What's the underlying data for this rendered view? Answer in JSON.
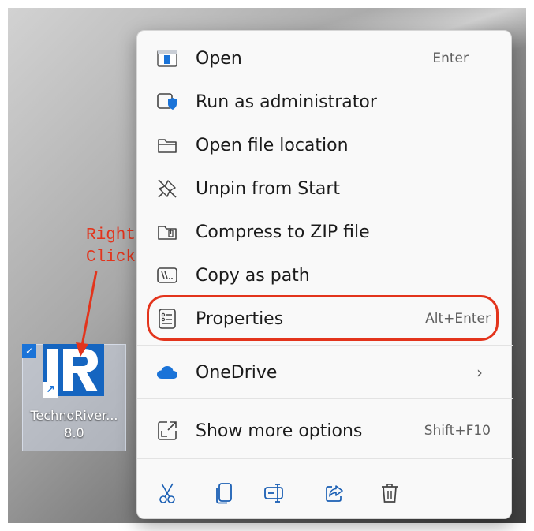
{
  "desktop": {
    "icon": {
      "label_line1": "TechnoRiver...",
      "label_line2": "8.0",
      "logo_letters": "IR",
      "checkbox_glyph": "✓",
      "shortcut_glyph": "↗"
    }
  },
  "annotation": {
    "text": "Right\nClick",
    "color": "#e3341c"
  },
  "context_menu": {
    "items": [
      {
        "label": "Open",
        "shortcut": "Enter",
        "icon": "open-app-icon"
      },
      {
        "label": "Run as administrator",
        "shortcut": "",
        "icon": "shield-admin-icon"
      },
      {
        "label": "Open file location",
        "shortcut": "",
        "icon": "folder-icon"
      },
      {
        "label": "Unpin from Start",
        "shortcut": "",
        "icon": "unpin-icon"
      },
      {
        "label": "Compress to ZIP file",
        "shortcut": "",
        "icon": "zip-folder-icon"
      },
      {
        "label": "Copy as path",
        "shortcut": "",
        "icon": "copy-path-icon"
      },
      {
        "label": "Properties",
        "shortcut": "Alt+Enter",
        "icon": "properties-icon"
      }
    ],
    "onedrive": {
      "label": "OneDrive",
      "icon": "cloud-icon",
      "chevron": "›"
    },
    "more": {
      "label": "Show more options",
      "shortcut": "Shift+F10",
      "icon": "show-more-icon"
    },
    "actions": [
      "cut-icon",
      "copy-icon",
      "rename-icon",
      "share-icon",
      "delete-icon"
    ]
  },
  "colors": {
    "accent": "#1a73d8",
    "highlight": "#e3341c",
    "menu_background": "#f9f9f9"
  }
}
